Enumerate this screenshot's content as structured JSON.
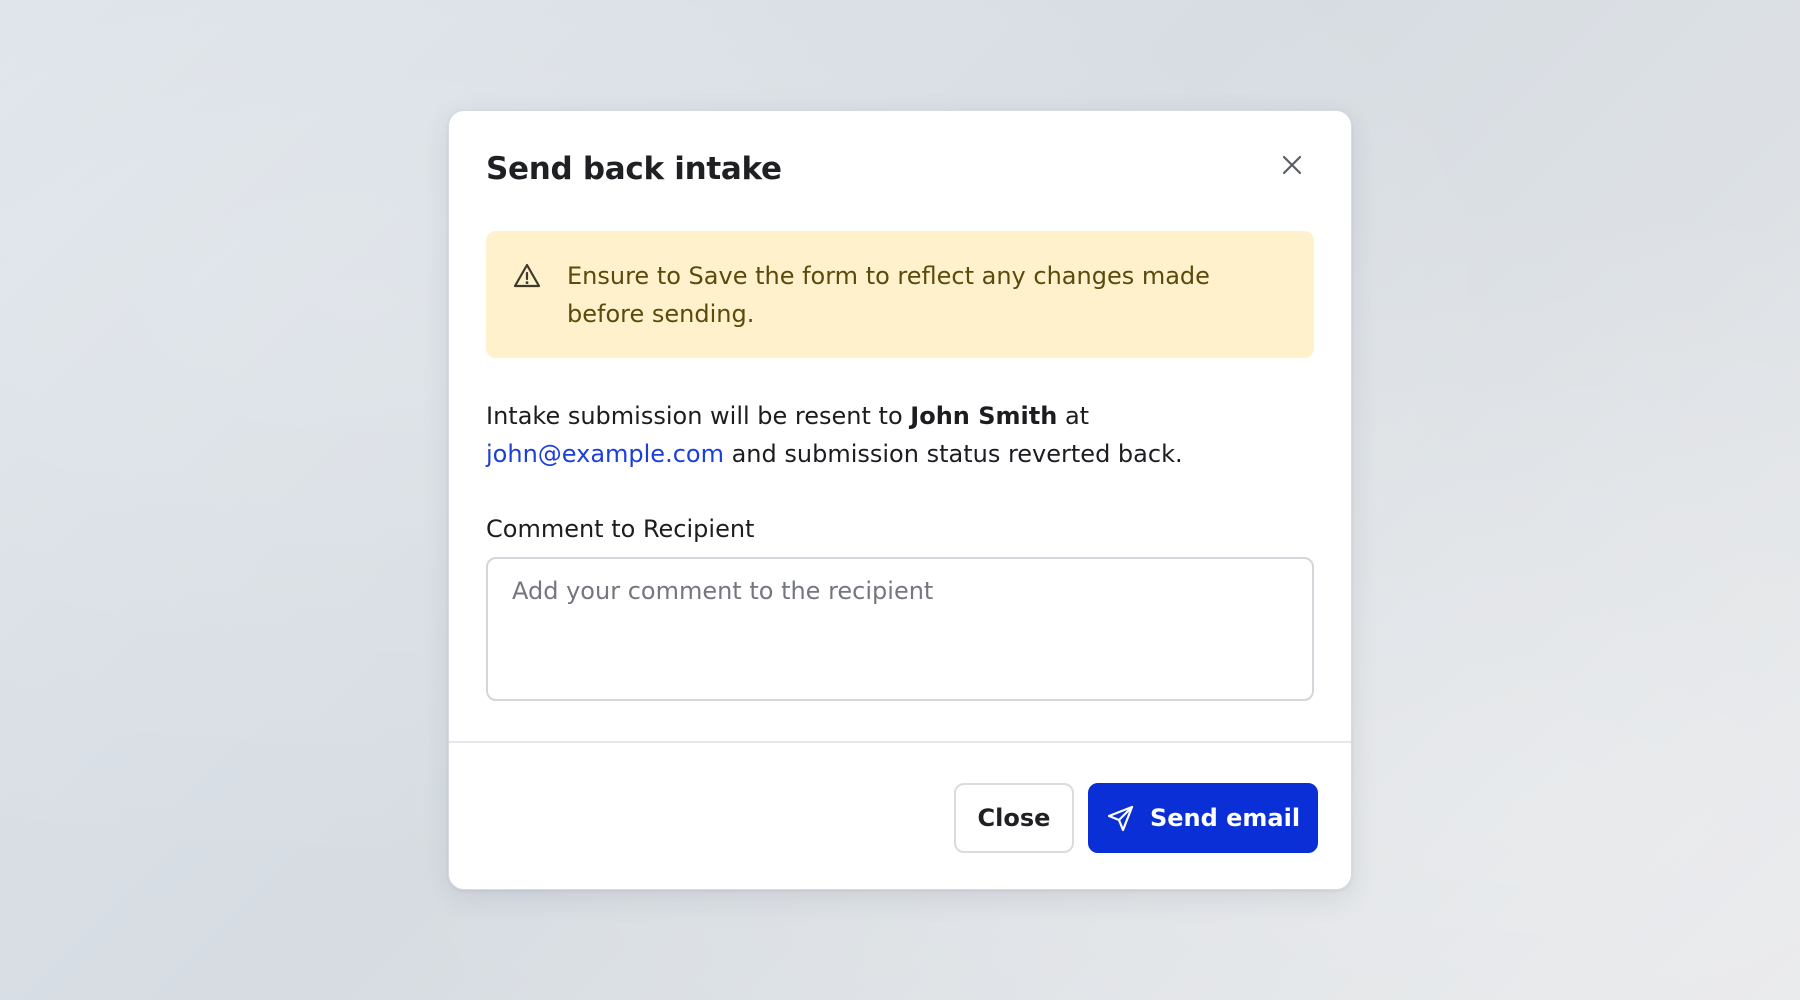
{
  "dialog": {
    "title": "Send back intake",
    "warning_text": "Ensure to Save the form to reflect any changes made before sending.",
    "info_prefix": "Intake submission will be resent to ",
    "recipient_name": "John Smith",
    "info_at": " at ",
    "recipient_email": "john@example.com",
    "info_suffix": " and submission status reverted back.",
    "comment_label": "Comment to Recipient",
    "comment_placeholder": "Add your comment to the recipient",
    "comment_value": "",
    "close_label": "Close",
    "send_label": "Send email"
  },
  "icons": {
    "dismiss": "close-icon",
    "warning": "warning-triangle-icon",
    "send": "paper-plane-icon"
  },
  "colors": {
    "primary": "#0a2fd6",
    "warning_bg": "#fef1cc",
    "warning_text": "#5c4a0d",
    "link": "#1d3fd9"
  }
}
